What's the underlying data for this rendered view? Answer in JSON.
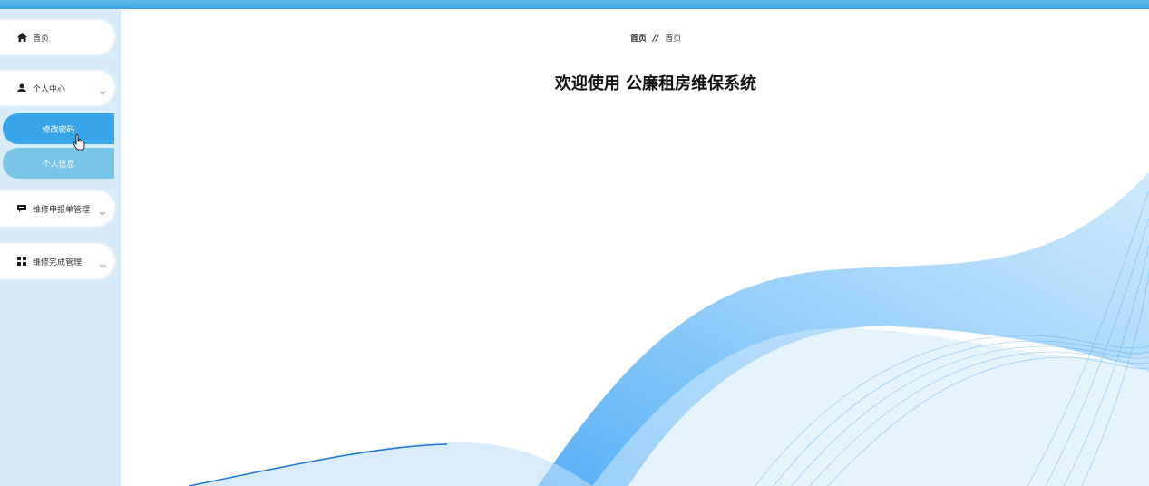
{
  "sidebar": {
    "items": [
      {
        "label": "首页",
        "icon": "home-icon"
      },
      {
        "label": "个人中心",
        "icon": "user-icon",
        "expanded": true,
        "children": [
          {
            "label": "修改密码",
            "active": true
          },
          {
            "label": "个人信息",
            "active": false
          }
        ]
      },
      {
        "label": "维修申报单管理",
        "icon": "message-icon"
      },
      {
        "label": "维修完成管理",
        "icon": "grid-icon"
      }
    ]
  },
  "breadcrumb": {
    "first": "首页",
    "separator": "//",
    "second": "首页"
  },
  "main": {
    "welcome": "欢迎使用 公廉租房维保系统"
  },
  "colors": {
    "accent": "#36a6e8",
    "accent_light": "#7ac4ea",
    "sidebar_bg": "#d7ecf8",
    "topbar": "#4aade4"
  }
}
